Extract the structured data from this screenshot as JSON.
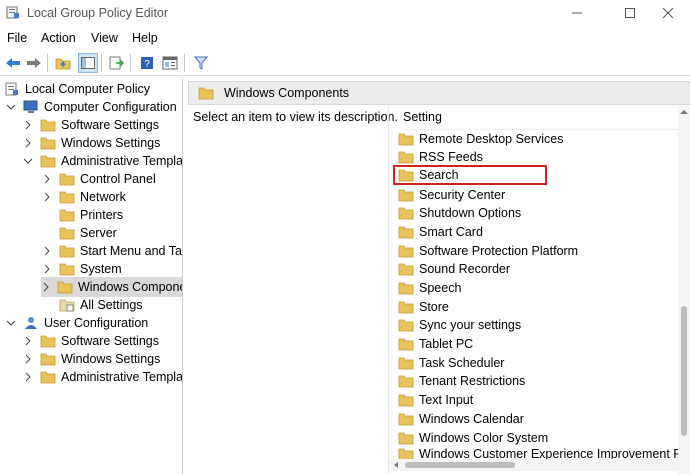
{
  "window": {
    "title": "Local Group Policy Editor"
  },
  "menu": {
    "items": [
      "File",
      "Action",
      "View",
      "Help"
    ]
  },
  "tree": {
    "items": [
      {
        "label": "Local Computer Policy",
        "icon": "policy-icon"
      },
      {
        "label": "Computer Configuration",
        "icon": "computer-icon"
      },
      {
        "label": "Software Settings",
        "icon": "folder-icon"
      },
      {
        "label": "Windows Settings",
        "icon": "folder-icon"
      },
      {
        "label": "Administrative Templat",
        "icon": "folder-icon"
      },
      {
        "label": "Control Panel",
        "icon": "folder-icon"
      },
      {
        "label": "Network",
        "icon": "folder-icon"
      },
      {
        "label": "Printers",
        "icon": "folder-icon"
      },
      {
        "label": "Server",
        "icon": "folder-icon"
      },
      {
        "label": "Start Menu and Task",
        "icon": "folder-icon"
      },
      {
        "label": "System",
        "icon": "folder-icon"
      },
      {
        "label": "Windows Compone",
        "icon": "folder-icon"
      },
      {
        "label": "All Settings",
        "icon": "folder-settings-icon"
      },
      {
        "label": "User Configuration",
        "icon": "user-icon"
      },
      {
        "label": "Software Settings",
        "icon": "folder-icon"
      },
      {
        "label": "Windows Settings",
        "icon": "folder-icon"
      },
      {
        "label": "Administrative Templat",
        "icon": "folder-icon"
      }
    ]
  },
  "right_pane": {
    "header": "Windows Components",
    "description": "Select an item to view its description.",
    "column_header": "Setting",
    "items": [
      "Remote Desktop Services",
      "RSS Feeds",
      "Search",
      "Security Center",
      "Shutdown Options",
      "Smart Card",
      "Software Protection Platform",
      "Sound Recorder",
      "Speech",
      "Store",
      "Sync your settings",
      "Tablet PC",
      "Task Scheduler",
      "Tenant Restrictions",
      "Text Input",
      "Windows Calendar",
      "Windows Color System",
      "Windows Customer Experience Improvement Prog"
    ],
    "highlighted_item": "Search"
  },
  "colors": {
    "highlight_border": "#d21f1f",
    "folder": "#e8c25a",
    "selection": "#d9d9d9"
  }
}
